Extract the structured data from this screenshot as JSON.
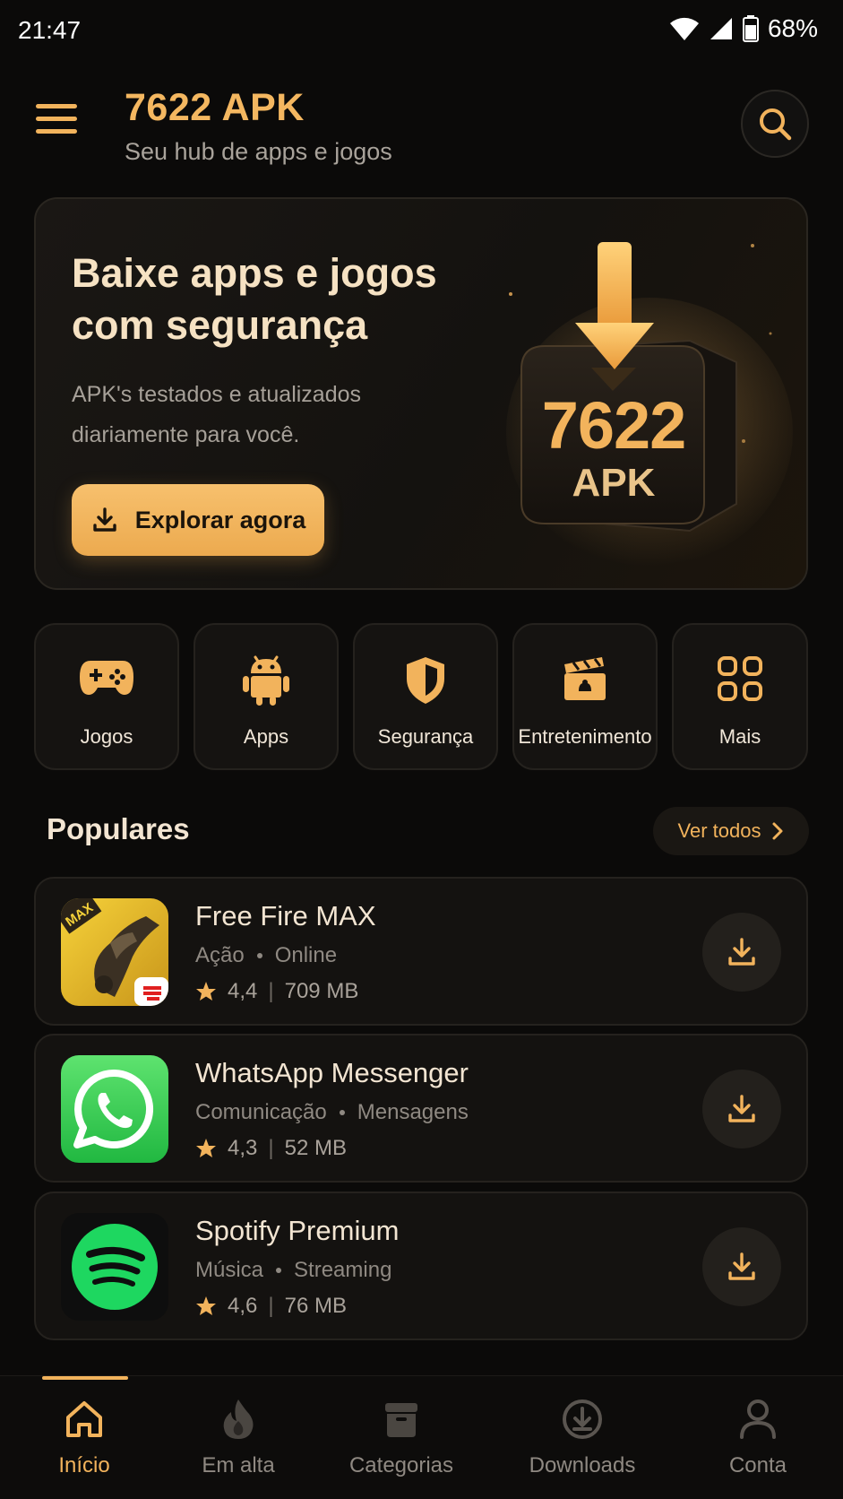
{
  "status_bar": {
    "time": "21:47",
    "battery": "68%"
  },
  "header": {
    "title": "7622 APK",
    "subtitle": "Seu hub de apps e jogos"
  },
  "hero": {
    "title_line1": "Baixe apps e jogos",
    "title_line2": "com segurança",
    "desc_line1": "APK's testados e atualizados",
    "desc_line2": "diariamente para você.",
    "cta_label": "Explorar agora",
    "art_number": "7622",
    "art_label": "APK"
  },
  "categories": [
    {
      "label": "Jogos",
      "icon": "gamepad-icon"
    },
    {
      "label": "Apps",
      "icon": "android-icon"
    },
    {
      "label": "Segurança",
      "icon": "shield-icon"
    },
    {
      "label": "Entretenimento",
      "icon": "clapperboard-icon"
    },
    {
      "label": "Mais",
      "icon": "grid-icon"
    }
  ],
  "popular": {
    "title": "Populares",
    "see_all": "Ver todos",
    "apps": [
      {
        "name": "Free Fire MAX",
        "genre": "Ação",
        "tag": "Online",
        "rating": "4,4",
        "size": "709 MB",
        "icon": "free-fire-icon",
        "icon_badge": "MAX"
      },
      {
        "name": "WhatsApp Messenger",
        "genre": "Comunicação",
        "tag": "Mensagens",
        "rating": "4,3",
        "size": "52 MB",
        "icon": "whatsapp-icon"
      },
      {
        "name": "Spotify Premium",
        "genre": "Música",
        "tag": "Streaming",
        "rating": "4,6",
        "size": "76 MB",
        "icon": "spotify-icon"
      }
    ]
  },
  "bottom_nav": [
    {
      "label": "Início",
      "icon": "home-icon",
      "active": true
    },
    {
      "label": "Em alta",
      "icon": "flame-icon",
      "active": false
    },
    {
      "label": "Categorias",
      "icon": "box-icon",
      "active": false
    },
    {
      "label": "Downloads",
      "icon": "download-circle-icon",
      "active": false
    },
    {
      "label": "Conta",
      "icon": "user-icon",
      "active": false
    }
  ],
  "colors": {
    "accent": "#f2b35c",
    "background": "#0b0a09",
    "card": "#141210"
  }
}
